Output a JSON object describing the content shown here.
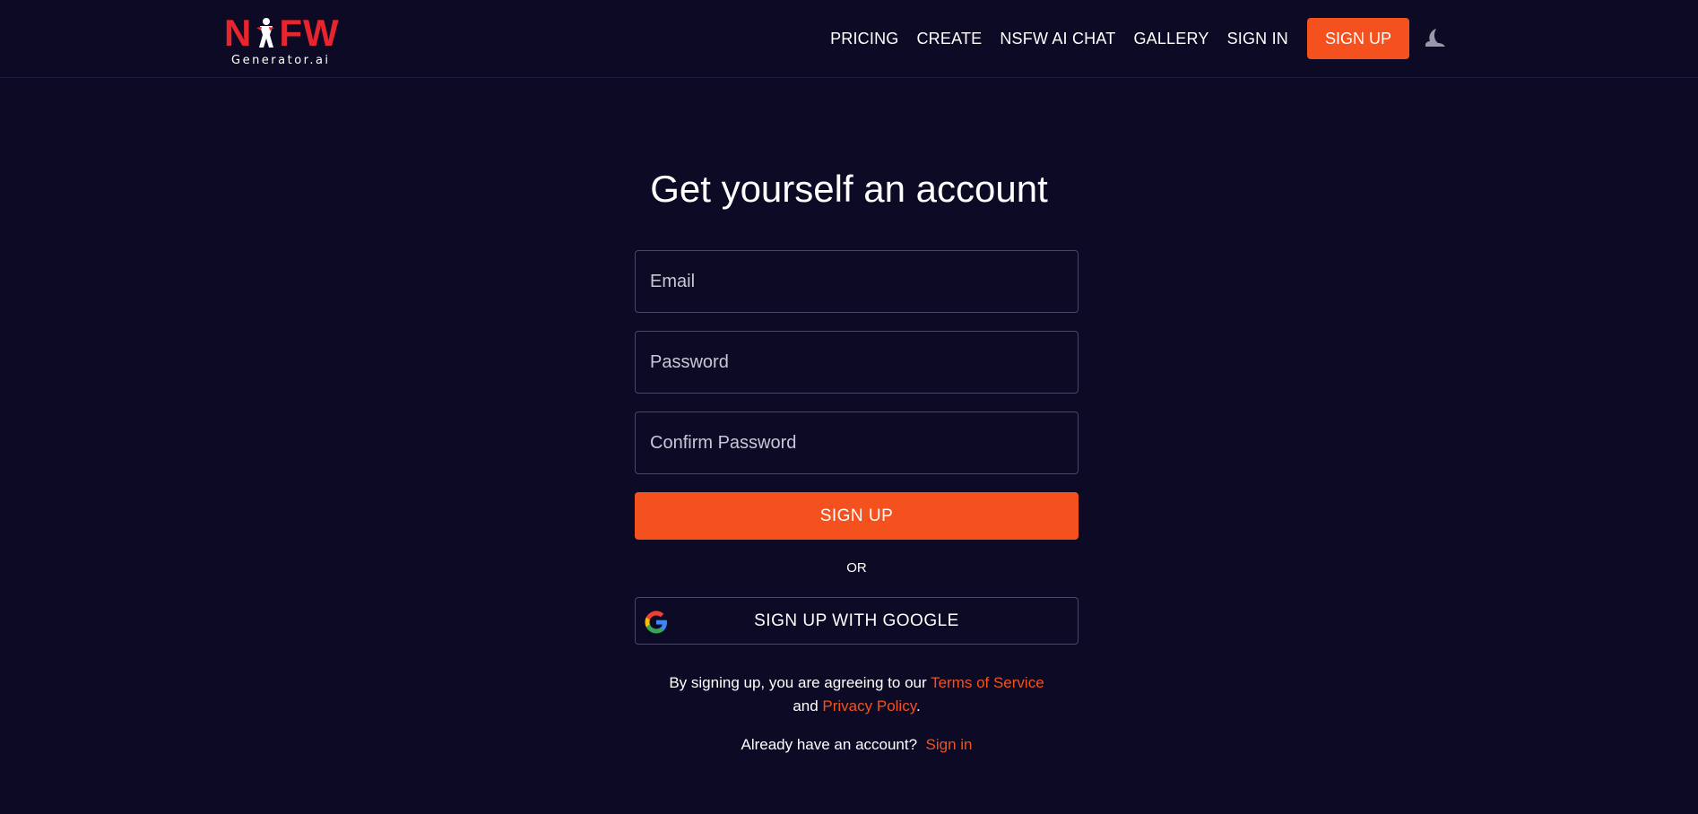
{
  "brand": {
    "logo_left": "N",
    "logo_right": "FW",
    "logo_sub": "Generator.ai",
    "accent_color": "#f4511e",
    "logo_color": "#e8242d",
    "background_color": "#0d0a26"
  },
  "nav": {
    "items": [
      {
        "label": "PRICING"
      },
      {
        "label": "CREATE"
      },
      {
        "label": "NSFW AI CHAT"
      },
      {
        "label": "GALLERY"
      },
      {
        "label": "SIGN IN"
      }
    ],
    "signup_label": "SIGN UP",
    "theme_icon": "moon-icon"
  },
  "form": {
    "title": "Get yourself an account",
    "email_placeholder": "Email",
    "password_placeholder": "Password",
    "confirm_placeholder": "Confirm Password",
    "submit_label": "SIGN UP",
    "or_label": "OR",
    "google_label": "SIGN UP WITH GOOGLE",
    "google_icon": "google-icon",
    "terms_prefix": "By signing up, you are agreeing to our ",
    "terms_link": "Terms of Service",
    "terms_and": "and ",
    "privacy_link": "Privacy Policy",
    "terms_suffix": ".",
    "already_text": "Already have an account?",
    "signin_link": "Sign in"
  }
}
